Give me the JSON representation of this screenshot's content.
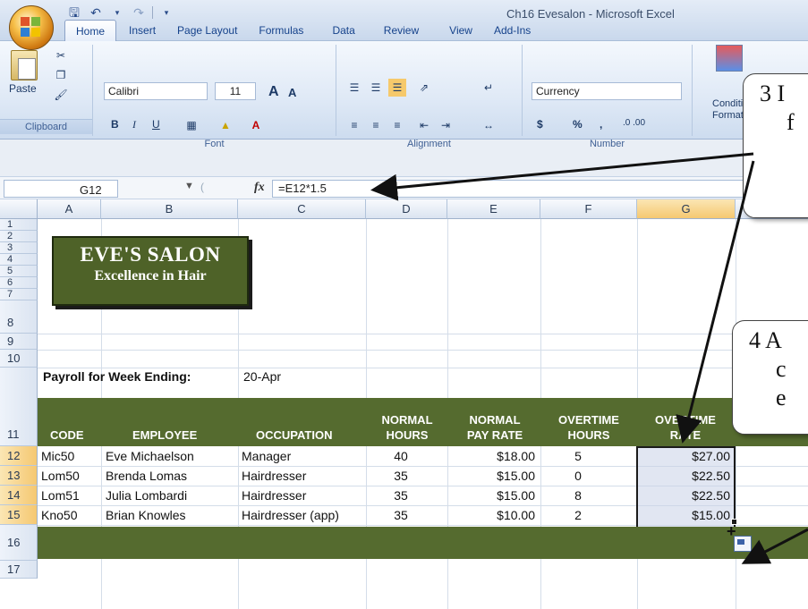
{
  "window": {
    "title": "Ch16 Evesalon - Microsoft Excel"
  },
  "tabs": [
    {
      "label": "Home",
      "active": true
    },
    {
      "label": "Insert"
    },
    {
      "label": "Page Layout"
    },
    {
      "label": "Formulas"
    },
    {
      "label": "Data"
    },
    {
      "label": "Review"
    },
    {
      "label": "View"
    },
    {
      "label": "Add-Ins"
    }
  ],
  "ribbon": {
    "clipboard": {
      "label": "Clipboard",
      "paste": "Paste"
    },
    "font": {
      "label": "Font",
      "name": "Calibri",
      "size": "11",
      "bold": "B",
      "italic": "I",
      "underline": "U",
      "grow": "A",
      "shrink": "A"
    },
    "alignment": {
      "label": "Alignment"
    },
    "number": {
      "label": "Number",
      "format": "Currency",
      "currency": "$",
      "percent": "%",
      "comma": ",",
      "inc_dec": ".0 .00"
    },
    "styles": {
      "conditional": "Conditio",
      "formatting": "Formatti"
    }
  },
  "formula_bar": {
    "name_box": "G12",
    "fx": "fx",
    "formula": "=E12*1.5"
  },
  "columns": [
    "A",
    "B",
    "C",
    "D",
    "E",
    "F",
    "G"
  ],
  "rows": [
    "1",
    "2",
    "3",
    "4",
    "5",
    "6",
    "7",
    "8",
    "9",
    "10",
    "11",
    "12",
    "13",
    "14",
    "15",
    "16",
    "17"
  ],
  "sheet": {
    "banner_title": "EVE'S SALON",
    "banner_subtitle": "Excellence in Hair",
    "payroll_label": "Payroll for Week Ending:",
    "payroll_date": "20-Apr",
    "headers": {
      "code": "CODE",
      "employee": "EMPLOYEE",
      "occupation": "OCCUPATION",
      "normal_hours_1": "NORMAL",
      "normal_hours_2": "HOURS",
      "pay_rate_1": "NORMAL",
      "pay_rate_2": "PAY RATE",
      "ot_hours_1": "OVERTIME",
      "ot_hours_2": "HOURS",
      "ot_rate_1": "OVERTIME",
      "ot_rate_2": "RATE"
    },
    "data": [
      {
        "code": "Mic50",
        "employee": "Eve Michaelson",
        "occupation": "Manager",
        "hours": "40",
        "rate": "$18.00",
        "ot_hours": "5",
        "ot_rate": "$27.00"
      },
      {
        "code": "Lom50",
        "employee": "Brenda Lomas",
        "occupation": "Hairdresser",
        "hours": "35",
        "rate": "$15.00",
        "ot_hours": "0",
        "ot_rate": "$22.50"
      },
      {
        "code": "Lom51",
        "employee": "Julia Lombardi",
        "occupation": "Hairdresser",
        "hours": "35",
        "rate": "$15.00",
        "ot_hours": "8",
        "ot_rate": "$22.50"
      },
      {
        "code": "Kno50",
        "employee": "Brian Knowles",
        "occupation": "Hairdresser (app)",
        "hours": "35",
        "rate": "$10.00",
        "ot_hours": "2",
        "ot_rate": "$15.00"
      }
    ]
  },
  "callouts": {
    "c3_line1": "3 I",
    "c3_line2": "f",
    "c4_line1": "4 A",
    "c4_line2": "c",
    "c4_line3": "e"
  }
}
